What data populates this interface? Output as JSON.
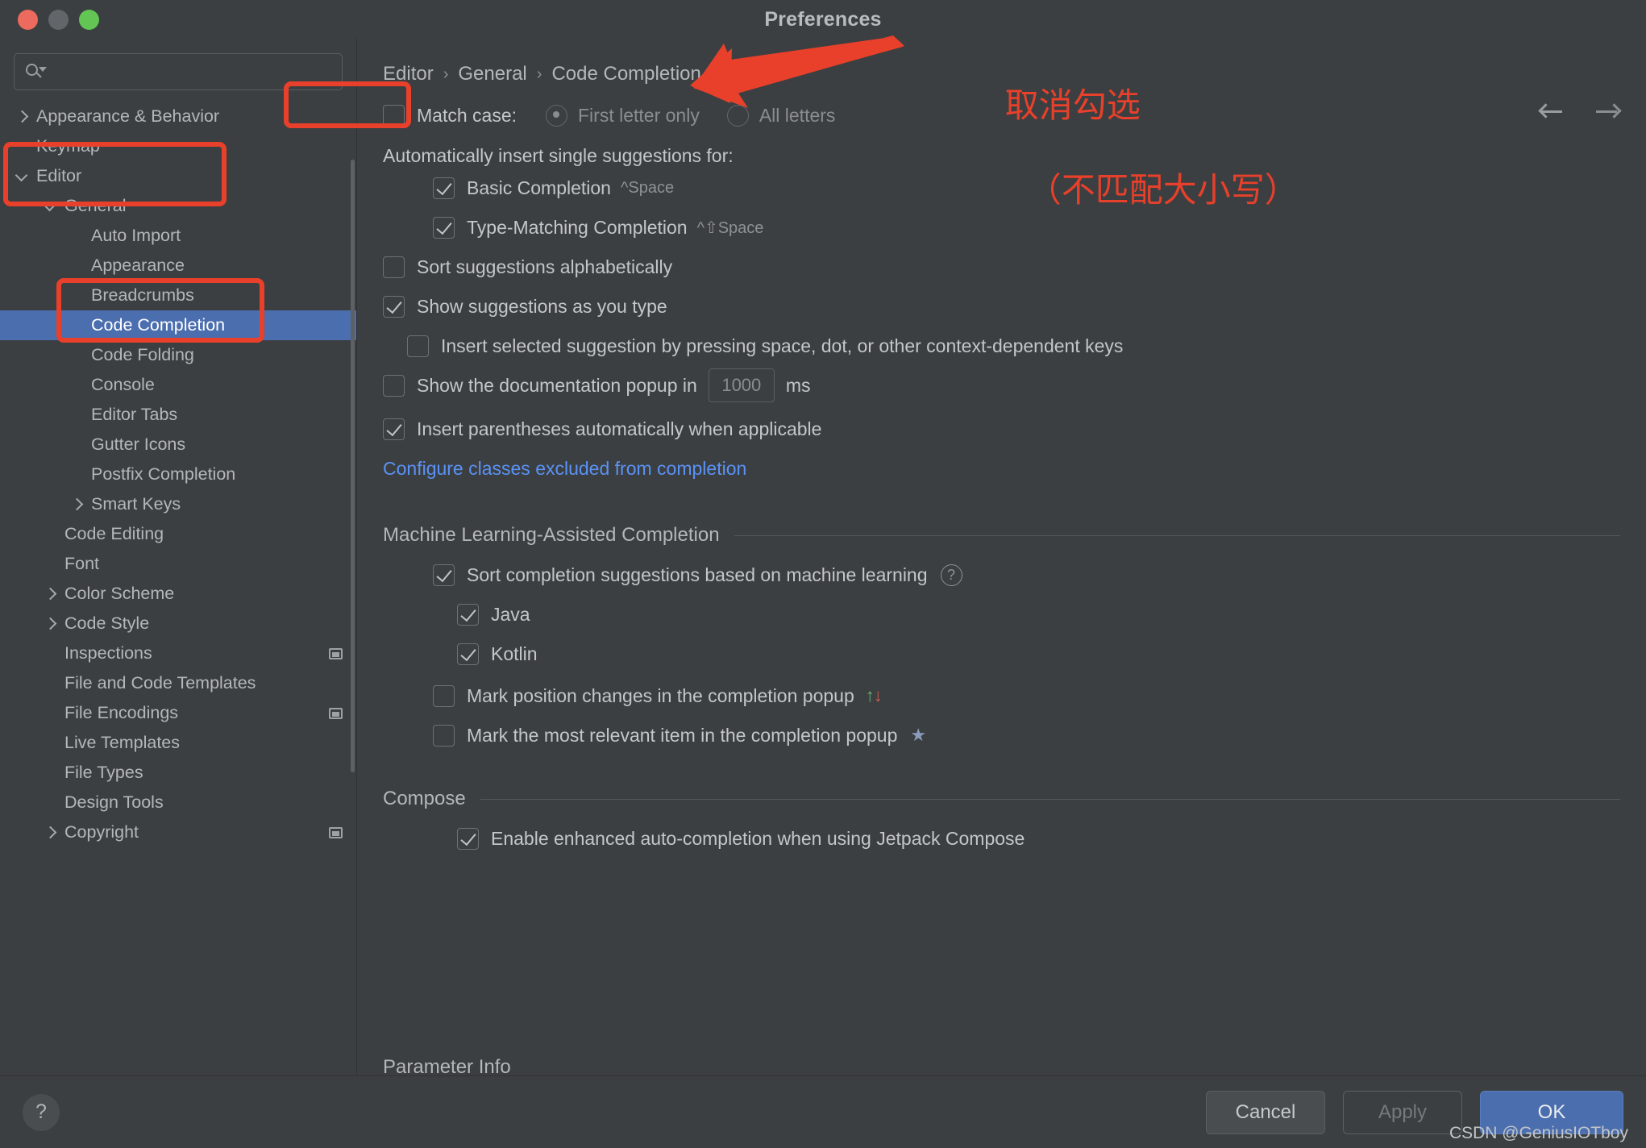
{
  "window": {
    "title": "Preferences",
    "traffic_lights": [
      "close-red",
      "minimize-gray",
      "maximize-green"
    ]
  },
  "sidebar": {
    "search": {
      "value": "",
      "placeholder": ""
    },
    "items": [
      {
        "label": "Appearance & Behavior",
        "level": 1,
        "arrow": "right",
        "selected": false,
        "badge": false
      },
      {
        "label": "Keymap",
        "level": 1,
        "arrow": "none",
        "selected": false,
        "badge": false
      },
      {
        "label": "Editor",
        "level": 1,
        "arrow": "down",
        "selected": false,
        "badge": false
      },
      {
        "label": "General",
        "level": 2,
        "arrow": "down",
        "selected": false,
        "badge": false
      },
      {
        "label": "Auto Import",
        "level": 3,
        "arrow": "none",
        "selected": false,
        "badge": false
      },
      {
        "label": "Appearance",
        "level": 3,
        "arrow": "none",
        "selected": false,
        "badge": false
      },
      {
        "label": "Breadcrumbs",
        "level": 3,
        "arrow": "none",
        "selected": false,
        "badge": false
      },
      {
        "label": "Code Completion",
        "level": 3,
        "arrow": "none",
        "selected": true,
        "badge": false
      },
      {
        "label": "Code Folding",
        "level": 3,
        "arrow": "none",
        "selected": false,
        "badge": false
      },
      {
        "label": "Console",
        "level": 3,
        "arrow": "none",
        "selected": false,
        "badge": false
      },
      {
        "label": "Editor Tabs",
        "level": 3,
        "arrow": "none",
        "selected": false,
        "badge": false
      },
      {
        "label": "Gutter Icons",
        "level": 3,
        "arrow": "none",
        "selected": false,
        "badge": false
      },
      {
        "label": "Postfix Completion",
        "level": 3,
        "arrow": "none",
        "selected": false,
        "badge": false
      },
      {
        "label": "Smart Keys",
        "level": 3,
        "arrow": "right",
        "selected": false,
        "badge": false
      },
      {
        "label": "Code Editing",
        "level": 2,
        "arrow": "none",
        "selected": false,
        "badge": false
      },
      {
        "label": "Font",
        "level": 2,
        "arrow": "none",
        "selected": false,
        "badge": false
      },
      {
        "label": "Color Scheme",
        "level": 2,
        "arrow": "right",
        "selected": false,
        "badge": false
      },
      {
        "label": "Code Style",
        "level": 2,
        "arrow": "right",
        "selected": false,
        "badge": false
      },
      {
        "label": "Inspections",
        "level": 2,
        "arrow": "none",
        "selected": false,
        "badge": true
      },
      {
        "label": "File and Code Templates",
        "level": 2,
        "arrow": "none",
        "selected": false,
        "badge": false
      },
      {
        "label": "File Encodings",
        "level": 2,
        "arrow": "none",
        "selected": false,
        "badge": true
      },
      {
        "label": "Live Templates",
        "level": 2,
        "arrow": "none",
        "selected": false,
        "badge": false
      },
      {
        "label": "File Types",
        "level": 2,
        "arrow": "none",
        "selected": false,
        "badge": false
      },
      {
        "label": "Design Tools",
        "level": 2,
        "arrow": "none",
        "selected": false,
        "badge": false
      },
      {
        "label": "Copyright",
        "level": 2,
        "arrow": "right",
        "selected": false,
        "badge": true
      }
    ]
  },
  "main": {
    "breadcrumb": [
      "Editor",
      "General",
      "Code Completion"
    ],
    "breadcrumb_separator": "›",
    "nav": {
      "back": "back-arrow",
      "forward": "forward-arrow"
    },
    "match_case": {
      "label": "Match case:",
      "checked": false,
      "options": [
        {
          "label": "First letter only",
          "selected": true
        },
        {
          "label": "All letters",
          "selected": false
        }
      ]
    },
    "auto_insert_header": "Automatically insert single suggestions for:",
    "auto_insert_items": [
      {
        "label": "Basic Completion",
        "shortcut": "^Space",
        "checked": true
      },
      {
        "label": "Type-Matching Completion",
        "shortcut": "^⇧Space",
        "checked": true
      }
    ],
    "options": [
      {
        "label": "Sort suggestions alphabetically",
        "checked": false
      },
      {
        "label": "Show suggestions as you type",
        "checked": true
      }
    ],
    "insert_selected": {
      "label": "Insert selected suggestion by pressing space, dot, or other context-dependent keys",
      "checked": false
    },
    "doc_popup": {
      "label_before": "Show the documentation popup in",
      "value": "1000",
      "label_after": "ms",
      "checked": false
    },
    "insert_parens": {
      "label": "Insert parentheses automatically when applicable",
      "checked": true
    },
    "configure_link": "Configure classes excluded from completion",
    "ml_section": {
      "title": "Machine Learning-Assisted Completion",
      "sort_ml": {
        "label": "Sort completion suggestions based on machine learning",
        "checked": true,
        "help": "?"
      },
      "languages": [
        {
          "label": "Java",
          "checked": true
        },
        {
          "label": "Kotlin",
          "checked": true
        }
      ],
      "mark_position": {
        "label": "Mark position changes in the completion popup",
        "checked": false,
        "icon": "up-down-arrows-icon"
      },
      "mark_relevant": {
        "label": "Mark the most relevant item in the completion popup",
        "checked": false,
        "icon": "star-icon"
      }
    },
    "compose_section": {
      "title": "Compose",
      "enable": {
        "label": "Enable enhanced auto-completion when using Jetpack Compose",
        "checked": true
      }
    },
    "cutoff_section_title": "Parameter Info"
  },
  "footer": {
    "help": "?",
    "cancel": "Cancel",
    "apply": "Apply",
    "ok": "OK"
  },
  "annotations": {
    "chinese_note_line1": "取消勾选",
    "chinese_note_line2": "（不匹配大小写）",
    "accent_color": "#e8402a",
    "watermark": "CSDN @GeniusIOTboy"
  }
}
